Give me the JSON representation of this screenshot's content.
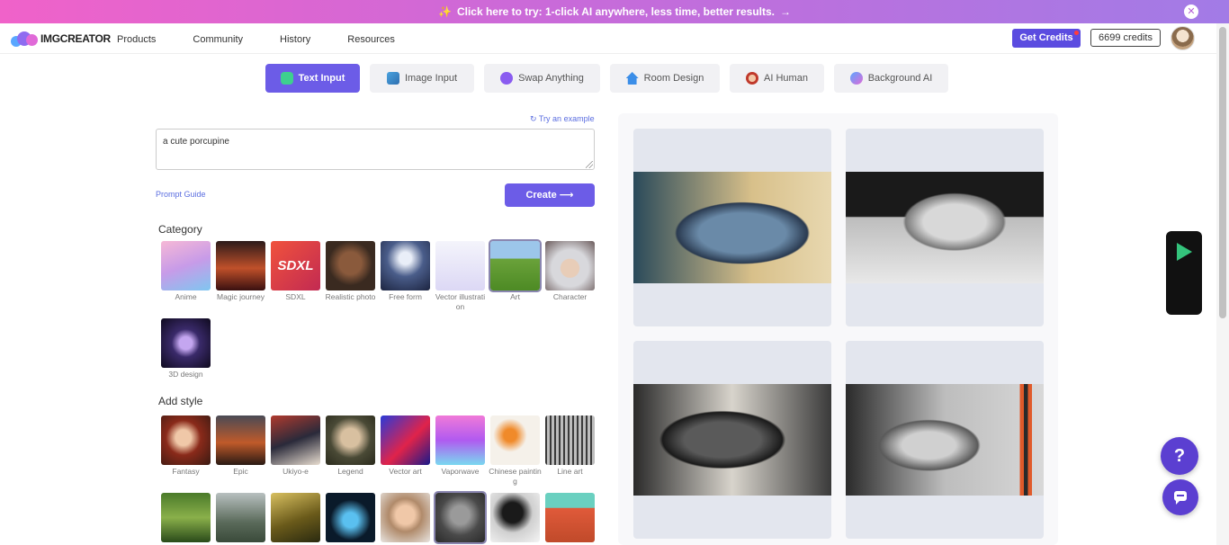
{
  "promo": {
    "text": "Click here to try: 1-click AI anywhere, less time, better results.",
    "arrow": "→",
    "close": "✕"
  },
  "nav": {
    "logo": "IMGCREATOR",
    "links": [
      "Products",
      "Community",
      "History",
      "Resources"
    ],
    "get_credits": "Get Credits",
    "credits": "6699 credits"
  },
  "tabs": [
    {
      "label": "Text Input",
      "icon": "text-input-icon",
      "active": true
    },
    {
      "label": "Image Input",
      "icon": "image-input-icon",
      "active": false
    },
    {
      "label": "Swap Anything",
      "icon": "swap-icon",
      "active": false
    },
    {
      "label": "Room Design",
      "icon": "house-icon",
      "active": false
    },
    {
      "label": "AI Human",
      "icon": "human-icon",
      "active": false
    },
    {
      "label": "Background AI",
      "icon": "background-icon",
      "active": false
    }
  ],
  "prompt": {
    "try_example": "Try an example",
    "value": "a cute porcupine",
    "guide": "Prompt Guide",
    "create": "Create"
  },
  "category": {
    "title": "Category",
    "items": [
      {
        "label": "Anime"
      },
      {
        "label": "Magic journey"
      },
      {
        "label": "SDXL"
      },
      {
        "label": "Realistic photo"
      },
      {
        "label": "Free form"
      },
      {
        "label": "Vector illustration"
      },
      {
        "label": "Art"
      },
      {
        "label": "Character"
      },
      {
        "label": "3D design"
      }
    ],
    "selected": "Art"
  },
  "style": {
    "title": "Add style",
    "items": [
      {
        "label": "Fantasy"
      },
      {
        "label": "Epic"
      },
      {
        "label": "Ukiyo-e"
      },
      {
        "label": "Legend"
      },
      {
        "label": "Vector art"
      },
      {
        "label": "Vaporwave"
      },
      {
        "label": "Chinese painting"
      },
      {
        "label": "Line art"
      }
    ]
  },
  "colors": {
    "accent": "#6c5ce7",
    "link": "#5b6ee0",
    "promo_start": "#f062c9",
    "promo_end": "#a27be6"
  }
}
